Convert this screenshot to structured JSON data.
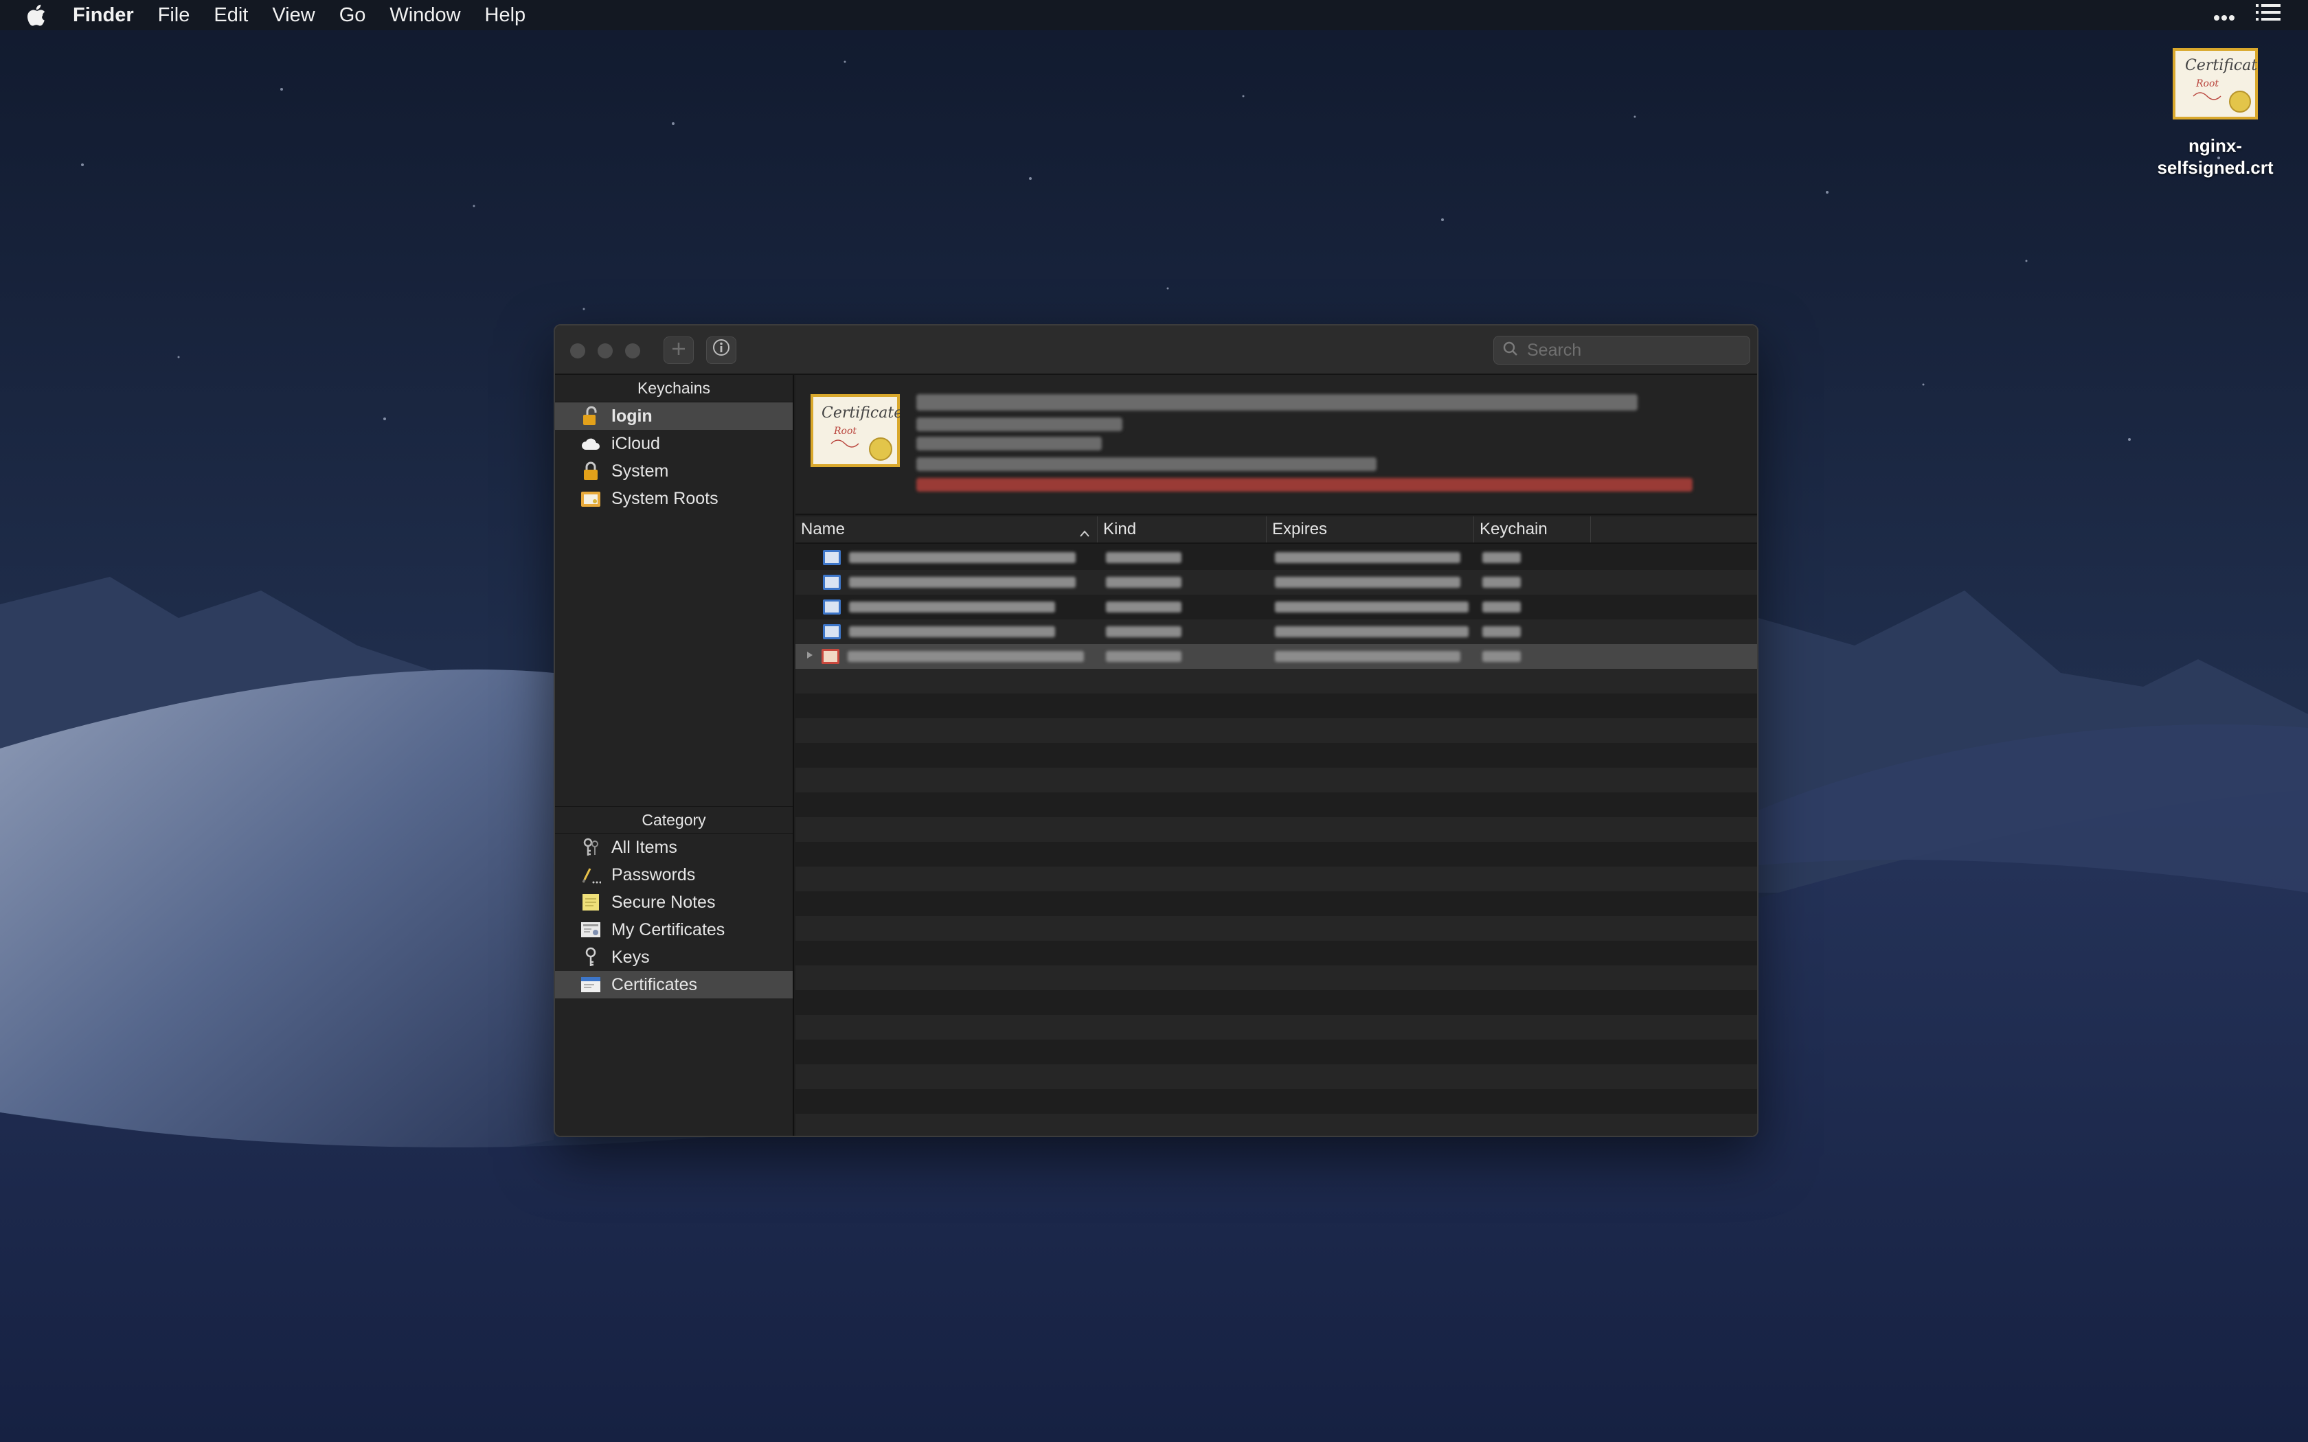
{
  "menubar": {
    "app_name": "Finder",
    "items": [
      "File",
      "Edit",
      "View",
      "Go",
      "Window",
      "Help"
    ],
    "right_icons": [
      "more-icon",
      "list-icon"
    ]
  },
  "desktop": {
    "file_label": "nginx-\nselfsigned.crt",
    "file_icon": "certificate-icon"
  },
  "window": {
    "toolbar": {
      "add_icon": "plus-icon",
      "info_icon": "info-icon",
      "search_placeholder": "Search"
    },
    "sidebar": {
      "keychains_header": "Keychains",
      "keychains": [
        {
          "label": "login",
          "icon": "unlocked-padlock-icon",
          "selected": true
        },
        {
          "label": "iCloud",
          "icon": "cloud-icon",
          "selected": false
        },
        {
          "label": "System",
          "icon": "padlock-icon",
          "selected": false
        },
        {
          "label": "System Roots",
          "icon": "folder-certificate-icon",
          "selected": false
        }
      ],
      "category_header": "Category",
      "categories": [
        {
          "label": "All Items",
          "icon": "keys-icon",
          "selected": false
        },
        {
          "label": "Passwords",
          "icon": "pencil-icon",
          "selected": false
        },
        {
          "label": "Secure Notes",
          "icon": "note-icon",
          "selected": false
        },
        {
          "label": "My Certificates",
          "icon": "my-certificate-icon",
          "selected": false
        },
        {
          "label": "Keys",
          "icon": "key-icon",
          "selected": false
        },
        {
          "label": "Certificates",
          "icon": "certificate-icon",
          "selected": true
        }
      ]
    },
    "table": {
      "columns": [
        "Name",
        "Kind",
        "Expires",
        "Keychain"
      ],
      "sort_column": "Name",
      "sort_direction": "ascending",
      "rows": [
        {
          "icon": "certificate-blue-icon",
          "selected": false,
          "expandable": false
        },
        {
          "icon": "certificate-blue-icon",
          "selected": false,
          "expandable": false
        },
        {
          "icon": "certificate-blue-icon",
          "selected": false,
          "expandable": false
        },
        {
          "icon": "certificate-blue-icon",
          "selected": false,
          "expandable": false
        },
        {
          "icon": "certificate-red-icon",
          "selected": true,
          "expandable": true
        }
      ]
    },
    "colors": {
      "selection": "#474747",
      "window_bg": "#1e1e1e",
      "sidebar_bg": "#232323"
    }
  }
}
